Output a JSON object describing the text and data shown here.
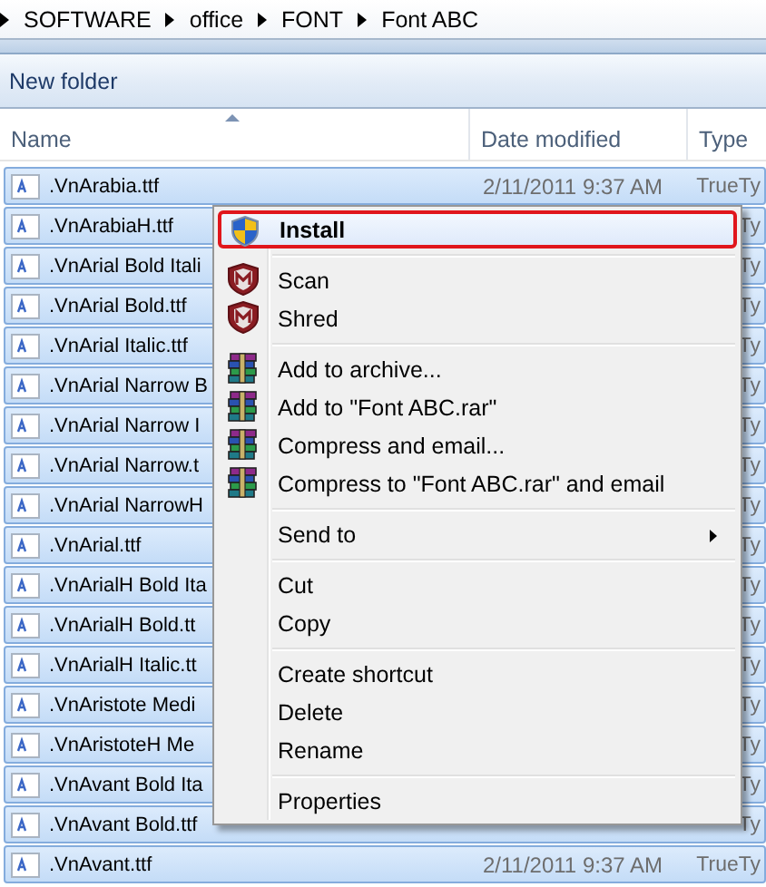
{
  "breadcrumb": {
    "items": [
      "SOFTWARE",
      "office",
      "FONT",
      "Font ABC"
    ]
  },
  "toolbar": {
    "buttons": [
      "New folder"
    ]
  },
  "columns": [
    "Name",
    "Date modified",
    "Type"
  ],
  "files": [
    {
      "name": ".VnArabia.ttf",
      "date": "2/11/2011 9:37 AM",
      "type": "TrueTy",
      "selected": true
    },
    {
      "name": ".VnArabiaH.ttf",
      "type": "Ty",
      "selected": true
    },
    {
      "name": ".VnArial Bold Itali",
      "type": "Ty",
      "selected": true
    },
    {
      "name": ".VnArial Bold.ttf",
      "type": "Ty",
      "selected": true
    },
    {
      "name": ".VnArial Italic.ttf",
      "type": "Ty",
      "selected": true
    },
    {
      "name": ".VnArial Narrow B",
      "type": "Ty",
      "selected": true
    },
    {
      "name": ".VnArial Narrow I",
      "type": "Ty",
      "selected": true
    },
    {
      "name": ".VnArial Narrow.t",
      "type": "Ty",
      "selected": true
    },
    {
      "name": ".VnArial NarrowH",
      "type": "Ty",
      "selected": true
    },
    {
      "name": ".VnArial.ttf",
      "type": "Ty",
      "selected": true
    },
    {
      "name": ".VnArialH Bold Ita",
      "type": "Ty",
      "selected": true
    },
    {
      "name": ".VnArialH Bold.tt",
      "type": "Ty",
      "selected": true
    },
    {
      "name": ".VnArialH Italic.tt",
      "type": "Ty",
      "selected": true
    },
    {
      "name": ".VnAristote Medi",
      "type": "Ty",
      "selected": true
    },
    {
      "name": ".VnAristoteH Me",
      "type": "Ty",
      "selected": true
    },
    {
      "name": ".VnAvant Bold Ita",
      "type": "Ty",
      "selected": true
    },
    {
      "name": ".VnAvant Bold.ttf",
      "type": "Ty",
      "selected": true
    },
    {
      "name": ".VnAvant.ttf",
      "date": "2/11/2011 9:37 AM",
      "type": "TrueTy",
      "selected": true
    }
  ],
  "context_menu": {
    "groups": [
      [
        {
          "label": "Install",
          "kind": "shield",
          "selected": true,
          "bold": true
        }
      ],
      [
        {
          "label": "Scan",
          "kind": "antivirus",
          "selected": false
        },
        {
          "label": "Shred",
          "kind": "antivirus",
          "selected": false
        }
      ],
      [
        {
          "label": "Add to archive...",
          "kind": "archive",
          "selected": false
        },
        {
          "label": "Add to \"Font ABC.rar\"",
          "kind": "archive",
          "selected": false
        },
        {
          "label": "Compress and email...",
          "kind": "archive",
          "selected": false
        },
        {
          "label": "Compress to \"Font ABC.rar\" and email",
          "kind": "archive",
          "selected": false
        }
      ],
      [
        {
          "label": "Send to",
          "kind": "plain",
          "submenu": true,
          "selected": false
        }
      ],
      [
        {
          "label": "Cut",
          "kind": "plain",
          "selected": false
        },
        {
          "label": "Copy",
          "kind": "plain",
          "selected": false
        }
      ],
      [
        {
          "label": "Create shortcut",
          "kind": "plain",
          "selected": false
        },
        {
          "label": "Delete",
          "kind": "plain",
          "selected": false
        },
        {
          "label": "Rename",
          "kind": "plain",
          "selected": false
        }
      ],
      [
        {
          "label": "Properties",
          "kind": "plain",
          "selected": false
        }
      ]
    ]
  }
}
